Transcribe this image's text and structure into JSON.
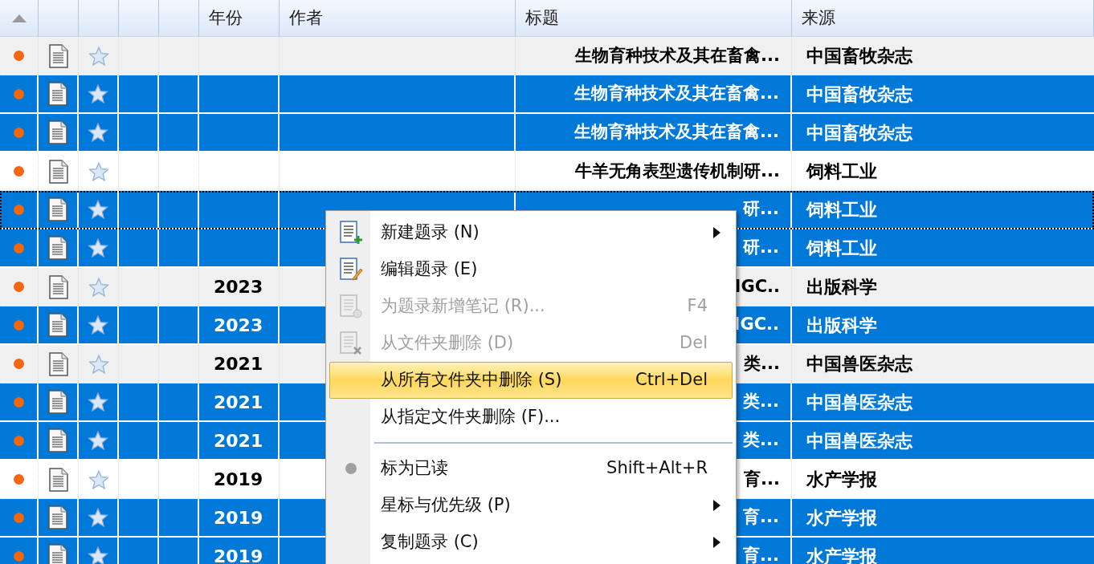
{
  "table": {
    "sort_ascending": true,
    "columns": [
      "年份",
      "作者",
      "标题",
      "来源"
    ],
    "rows": [
      {
        "selected": false,
        "shaded": true,
        "focused": false,
        "unread": true,
        "title": "生物育种技术及其在畜禽...",
        "source": "中国畜牧杂志"
      },
      {
        "selected": true,
        "focused": false,
        "unread": true,
        "title": "生物育种技术及其在畜禽...",
        "source": "中国畜牧杂志"
      },
      {
        "selected": true,
        "focused": false,
        "unread": true,
        "title": "生物育种技术及其在畜禽...",
        "source": "中国畜牧杂志"
      },
      {
        "selected": false,
        "shaded": false,
        "focused": false,
        "unread": true,
        "title": "牛羊无角表型遗传机制研...",
        "source": "饲料工业"
      },
      {
        "selected": true,
        "focused": true,
        "unread": true,
        "title": "研...",
        "source": "饲料工业"
      },
      {
        "selected": true,
        "focused": false,
        "unread": true,
        "title": "研...",
        "source": "饲料工业"
      },
      {
        "selected": false,
        "shaded": true,
        "focused": false,
        "unread": true,
        "year": "2023",
        "title": "IGC..",
        "source": "出版科学"
      },
      {
        "selected": true,
        "focused": false,
        "unread": true,
        "year": "2023",
        "title": "IGC..",
        "source": "出版科学"
      },
      {
        "selected": false,
        "shaded": true,
        "focused": false,
        "unread": true,
        "year": "2021",
        "title": "类...",
        "source": "中国兽医杂志"
      },
      {
        "selected": true,
        "focused": false,
        "unread": true,
        "year": "2021",
        "title": "类...",
        "source": "中国兽医杂志"
      },
      {
        "selected": true,
        "focused": false,
        "unread": true,
        "year": "2021",
        "title": "类...",
        "source": "中国兽医杂志"
      },
      {
        "selected": false,
        "shaded": false,
        "focused": false,
        "unread": true,
        "year": "2019",
        "title": "育...",
        "source": "水产学报"
      },
      {
        "selected": true,
        "focused": false,
        "unread": true,
        "year": "2019",
        "title": "育...",
        "source": "水产学报"
      },
      {
        "selected": true,
        "focused": false,
        "unread": true,
        "year": "2019",
        "title": "育...",
        "source": "水产学报"
      }
    ]
  },
  "context_menu": {
    "items": [
      {
        "kind": "item",
        "label": "新建题录 (N)",
        "disabled": false,
        "selected": false,
        "submenu": true
      },
      {
        "kind": "item",
        "label": "编辑题录 (E)",
        "disabled": false,
        "selected": false,
        "submenu": false
      },
      {
        "kind": "item",
        "label": "为题录新增笔记 (R)...",
        "shortcut": "F4",
        "disabled": true,
        "selected": false,
        "submenu": false
      },
      {
        "kind": "item",
        "label": "从文件夹删除 (D)",
        "shortcut": "Del",
        "disabled": true,
        "selected": false,
        "submenu": false
      },
      {
        "kind": "item",
        "label": "从所有文件夹中删除 (S)",
        "shortcut": "Ctrl+Del",
        "disabled": false,
        "selected": true,
        "submenu": false
      },
      {
        "kind": "item",
        "label": "从指定文件夹删除 (F)...",
        "disabled": false,
        "selected": false,
        "submenu": false
      },
      {
        "kind": "separator"
      },
      {
        "kind": "item",
        "label": "标为已读",
        "shortcut": "Shift+Alt+R",
        "disabled": false,
        "selected": false,
        "submenu": false
      },
      {
        "kind": "item",
        "label": "星标与优先级 (P)",
        "disabled": false,
        "selected": false,
        "submenu": true
      },
      {
        "kind": "item",
        "label": "复制题录 (C)",
        "disabled": false,
        "selected": false,
        "submenu": true
      }
    ]
  }
}
